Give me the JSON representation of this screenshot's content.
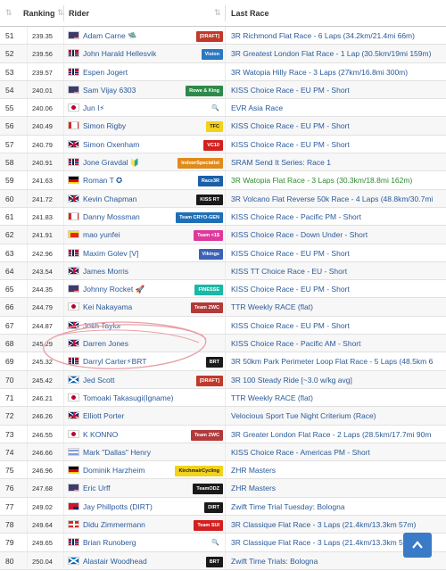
{
  "header": {
    "ranking": "Ranking",
    "rider": "Rider",
    "last_race": "Last Race"
  },
  "rows": [
    {
      "pos": "51",
      "score": "239.35",
      "name": "Adam Carne 🛸",
      "flag": "us",
      "badge": "[DRAFT]",
      "bcolor": "#c0392b",
      "race": "3R Richmond Flat Race - 6 Laps (34.2km/21.4mi 66m)"
    },
    {
      "pos": "52",
      "score": "239.56",
      "name": "John Harald Hellesvik",
      "flag": "no",
      "badge": "Vision",
      "bcolor": "#2b78c2",
      "race": "3R Greatest London Flat Race - 1 Lap (30.5km/19mi 159m)"
    },
    {
      "pos": "53",
      "score": "239.57",
      "name": "Espen Jogert",
      "flag": "no",
      "badge": "",
      "race": "3R Watopia Hilly Race - 3 Laps (27km/16.8mi 300m)"
    },
    {
      "pos": "54",
      "score": "240.01",
      "name": "Sam Vijay 6303",
      "flag": "us",
      "badge": "Rowe & King",
      "bcolor": "#2d8a4a",
      "race": "KISS Choice Race - EU PM - Short"
    },
    {
      "pos": "55",
      "score": "240.06",
      "name": "Jun I⚡",
      "flag": "jp",
      "badge": "🔍",
      "bcolor": "",
      "race": "EVR Asia Race"
    },
    {
      "pos": "56",
      "score": "240.49",
      "name": "Simon Rigby",
      "flag": "ca",
      "badge": "TFC",
      "bcolor": "#f2d21a",
      "race": "KISS Choice Race - EU PM - Short"
    },
    {
      "pos": "57",
      "score": "240.79",
      "name": "Simon Oxenham",
      "flag": "gb",
      "badge": "VC10",
      "bcolor": "#d21f1f",
      "race": "KISS Choice Race - EU PM - Short"
    },
    {
      "pos": "58",
      "score": "240.91",
      "name": "Jone Gravdal 🔰",
      "flag": "no",
      "badge": "IndoorSpecialist",
      "bcolor": "#e08a1a",
      "race": "SRAM Send It Series: Race 1"
    },
    {
      "pos": "59",
      "score": "241.63",
      "name": "Roman T ✪",
      "flag": "de",
      "badge": "Race3R",
      "bcolor": "#1a5fa8",
      "race": "3R Watopia Flat Race - 3 Laps (30.3km/18.8mi 162m)",
      "green": true
    },
    {
      "pos": "60",
      "score": "241.72",
      "name": "Kevin Chapman",
      "flag": "gb",
      "badge": "KISS RT",
      "bcolor": "#1a1a1a",
      "race": "3R Volcano Flat Reverse 50k Race - 4 Laps (48.8km/30.7mi"
    },
    {
      "pos": "61",
      "score": "241.83",
      "name": "Danny Mossman",
      "flag": "ca",
      "badge": "Team CRYO-GEN",
      "bcolor": "#1f6fb5",
      "race": "KISS Choice Race - Pacific PM - Short"
    },
    {
      "pos": "62",
      "score": "241.91",
      "name": "mao yunfei",
      "flag": "cn",
      "badge": "Team <1$",
      "bcolor": "#e0389a",
      "race": "KISS Choice Race - Down Under - Short"
    },
    {
      "pos": "63",
      "score": "242.96",
      "name": "Maxim Golev [V]",
      "flag": "no",
      "badge": "Vikings",
      "bcolor": "#3b62b5",
      "race": "KISS Choice Race - EU PM - Short"
    },
    {
      "pos": "64",
      "score": "243.54",
      "name": "James Morris",
      "flag": "gb",
      "badge": "",
      "race": "KISS TT Choice Race - EU - Short"
    },
    {
      "pos": "65",
      "score": "244.35",
      "name": "Johnny Rocket 🚀",
      "flag": "us",
      "badge": "FINESSE",
      "bcolor": "#1ab8a6",
      "race": "KISS Choice Race - EU PM - Short"
    },
    {
      "pos": "66",
      "score": "244.79",
      "name": "Kei Nakayama",
      "flag": "jp",
      "badge": "Team ZWC",
      "bcolor": "#b23a3a",
      "race": "TTR Weekly RACE (flat)"
    },
    {
      "pos": "67",
      "score": "244.87",
      "name": "Josh Taylor",
      "flag": "gb",
      "badge": "",
      "race": "KISS Choice Race - EU PM - Short"
    },
    {
      "pos": "68",
      "score": "245.29",
      "name": "Darren Jones",
      "flag": "gb",
      "badge": "",
      "race": "KISS Choice Race - Pacific AM - Short"
    },
    {
      "pos": "69",
      "score": "245.32",
      "name": "Darryl Carter⚡BRT",
      "flag": "no",
      "badge": "BRT",
      "bcolor": "#1a1a1a",
      "race": "3R 50km Park Perimeter Loop Flat Race - 5 Laps (48.5km 6"
    },
    {
      "pos": "70",
      "score": "245.42",
      "name": "Jed Scott",
      "flag": "sc",
      "badge": "[DRAFT]",
      "bcolor": "#c0392b",
      "race": "3R 100 Steady Ride [~3.0 w/kg avg]"
    },
    {
      "pos": "71",
      "score": "246.21",
      "name": "Tomoaki Takasugi(Igname)",
      "flag": "jp",
      "badge": "",
      "race": "TTR Weekly RACE (flat)"
    },
    {
      "pos": "72",
      "score": "246.26",
      "name": "Elliott Porter",
      "flag": "gb",
      "badge": "",
      "race": "Velocious Sport Tue Night Criterium (Race)"
    },
    {
      "pos": "73",
      "score": "246.55",
      "name": "K KONNO",
      "flag": "jp",
      "badge": "Team ZWC",
      "bcolor": "#b23a3a",
      "race": "3R Greater London Flat Race - 2 Laps (28.5km/17.7mi 90m"
    },
    {
      "pos": "74",
      "score": "246.66",
      "name": "Mark \"Dallas\" Henry",
      "flag": "il",
      "badge": "",
      "race": "KISS Choice Race - Americas PM - Short"
    },
    {
      "pos": "75",
      "score": "246.96",
      "name": "Dominik Harzheim",
      "flag": "de",
      "badge": "KirchmairCycling",
      "bcolor": "#f2d21a",
      "race": "ZHR Masters"
    },
    {
      "pos": "76",
      "score": "247.68",
      "name": "Eric Urff",
      "flag": "us",
      "badge": "TeamODZ",
      "bcolor": "#1a1a1a",
      "race": "ZHR Masters"
    },
    {
      "pos": "77",
      "score": "249.02",
      "name": "Jay Phillpotts (DIRT)",
      "flag": "au",
      "badge": "DIRT",
      "bcolor": "#1a1a1a",
      "race": "Zwift Time Trial Tuesday: Bologna"
    },
    {
      "pos": "78",
      "score": "249.64",
      "name": "Didu Zimmermann",
      "flag": "ch",
      "badge": "Team SUI",
      "bcolor": "#d21f1f",
      "race": "3R Classique Flat Race - 3 Laps (21.4km/13.3km 57m)"
    },
    {
      "pos": "79",
      "score": "249.65",
      "name": "Brian Runoberg",
      "flag": "no",
      "badge": "🔍",
      "bcolor": "",
      "race": "3R Classique Flat Race - 3 Laps (21.4km/13.3km 57m)"
    },
    {
      "pos": "80",
      "score": "250.04",
      "name": "Alastair Woodhead",
      "flag": "sc",
      "badge": "BRT",
      "bcolor": "#1a1a1a",
      "race": "Zwift Time Trials: Bologna"
    }
  ],
  "colors": {
    "link": "#2a5a9a",
    "accent_button": "#3a7bc8",
    "scribble": "#e8a0a8"
  }
}
